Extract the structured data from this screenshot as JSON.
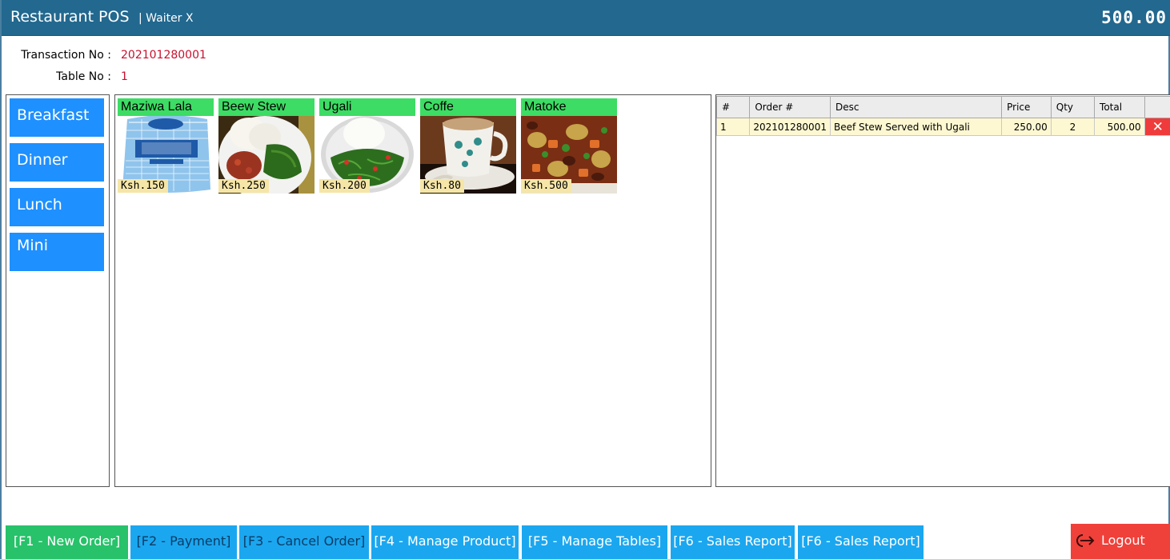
{
  "header": {
    "app_title": "Restaurant POS",
    "waiter": "| Waiter X",
    "total": "500.00"
  },
  "transaction": {
    "transaction_label": "Transaction No :",
    "transaction_no": "202101280001",
    "table_label": "Table No :",
    "table_no": "1"
  },
  "categories": [
    {
      "label": "Breakfast"
    },
    {
      "label": "Dinner"
    },
    {
      "label": "Lunch"
    },
    {
      "label": "Mini"
    }
  ],
  "products": [
    {
      "name": "Maziwa Lala",
      "price": "Ksh.150",
      "image": "milk-carton-image"
    },
    {
      "name": "Beew Stew",
      "price": "Ksh.250",
      "image": "beef-stew-image"
    },
    {
      "name": "Ugali",
      "price": "Ksh.200",
      "image": "ugali-image"
    },
    {
      "name": "Coffe",
      "price": "Ksh.80",
      "image": "coffee-cup-image"
    },
    {
      "name": "Matoke",
      "price": "Ksh.500",
      "image": "matoke-image"
    }
  ],
  "order_table": {
    "columns": [
      "#",
      "Order #",
      "Desc",
      "Price",
      "Qty",
      "Total",
      ""
    ],
    "rows": [
      {
        "index": "1",
        "order_no": "202101280001",
        "desc": "Beef Stew Served with Ugali",
        "price": "250.00",
        "qty": "2",
        "total": "500.00",
        "delete_icon": "✕"
      }
    ]
  },
  "function_buttons": [
    {
      "label": "[F1 - New Order]"
    },
    {
      "label": "[F2 - Payment]"
    },
    {
      "label": "[F3 - Cancel Order]"
    },
    {
      "label": "[F4 - Manage Product]"
    },
    {
      "label": "[F5 - Manage Tables]"
    },
    {
      "label": "[F6 - Sales Report]"
    },
    {
      "label": "[F6 - Sales Report]"
    }
  ],
  "logout": {
    "label": "Logout",
    "icon": "logout-icon"
  },
  "colors": {
    "title_bar": "#22688f",
    "category_button": "#1e90ff",
    "product_name_bg": "#3ddc64",
    "price_tag_bg": "#f5e6a8",
    "new_order_button": "#27c26a",
    "function_button": "#1aa7f0",
    "logout_button": "#f0403a",
    "delete_button": "#ef3b3b",
    "order_row_bg": "#fdf8d2",
    "highlight_text": "#c8102e"
  }
}
